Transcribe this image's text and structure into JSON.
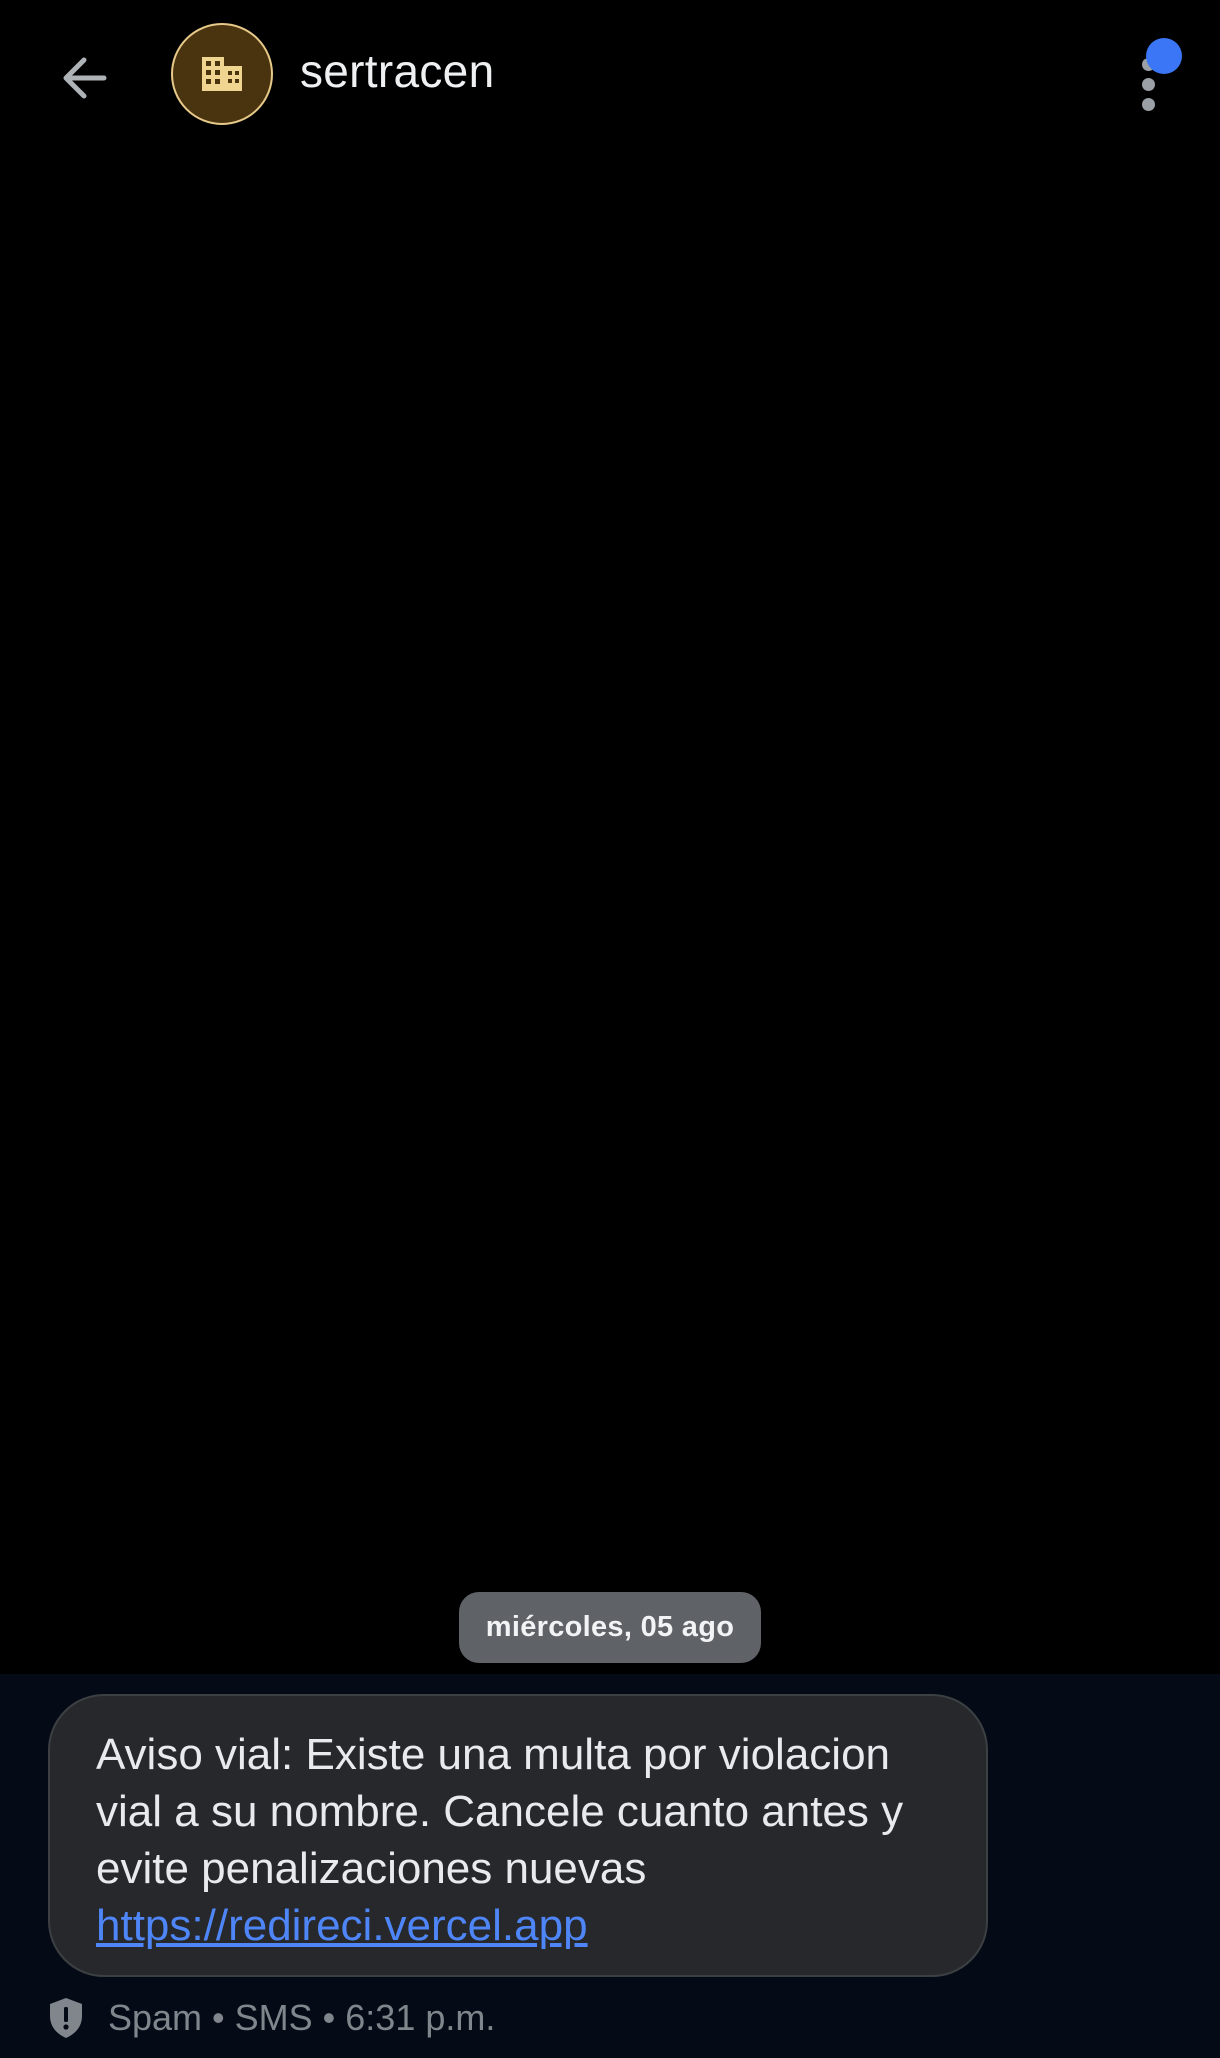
{
  "header": {
    "contact_name": "sertracen",
    "back_icon": "arrow-left-icon",
    "avatar_icon": "building-icon",
    "menu_icon": "more-vertical-icon",
    "avatar_color": "#4a3410",
    "notification_color": "#3b76f6"
  },
  "conversation": {
    "date_separator": "miércoles, 05 ago",
    "messages": [
      {
        "text": "Aviso vial: Existe una multa por violacion vial a su nombre. Cancele cuanto antes y evite penalizaciones nuevas ",
        "link": "https://redireci.vercel.app",
        "status_icon": "spam-shield-icon",
        "status": "Spam • SMS • 6:31 p.m."
      }
    ]
  },
  "colors": {
    "background": "#000000",
    "bubble": "#26282c",
    "link": "#4f86f7",
    "date_chip": "#5f6368"
  }
}
